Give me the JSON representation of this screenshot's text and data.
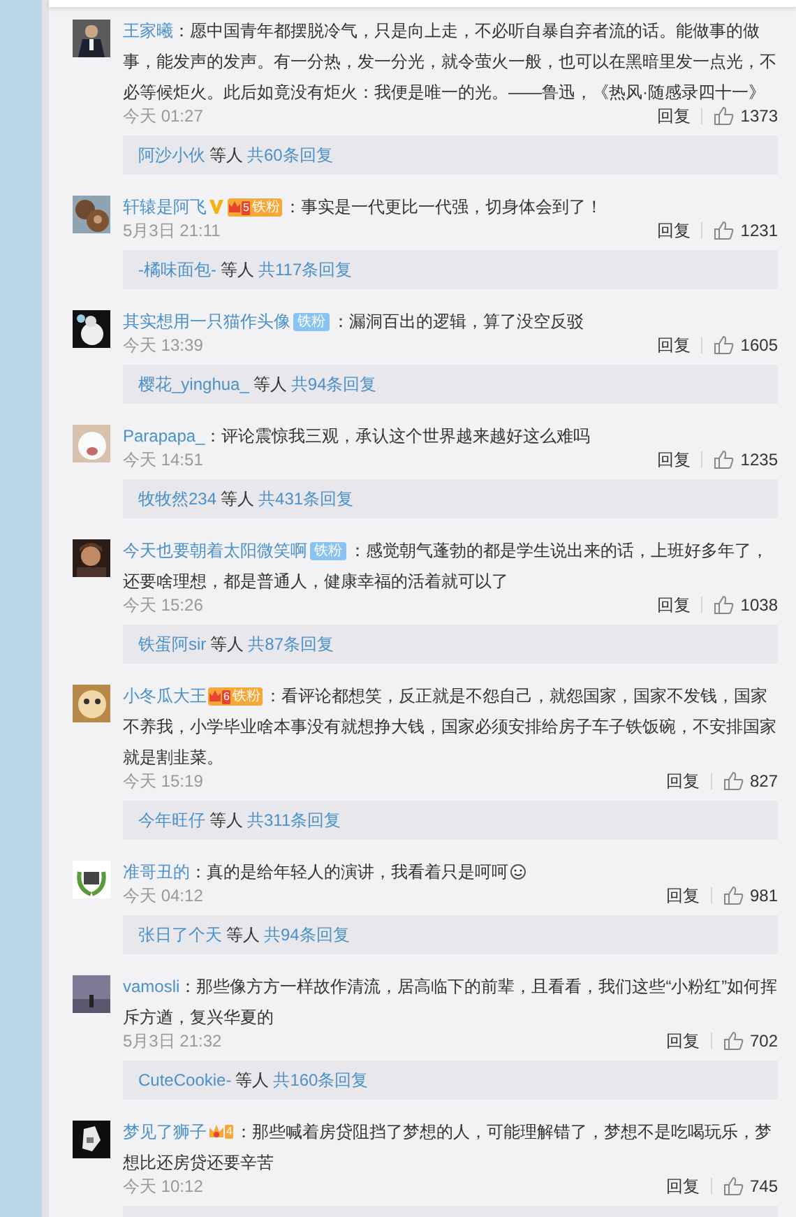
{
  "comments": [
    {
      "name": "王家曦",
      "text": "：愿中国青年都摆脱冷气，只是向上走，不必听自暴自弃者流的话。能做事的做事，能发声的发声。有一分热，发一分光，就令萤火一般，也可以在黑暗里发一点光，不必等候炬火。此后如竟没有炬火：我便是唯一的光。——鲁迅，《热风·随感录四十一》",
      "time": "今天 01:27",
      "reply": "回复",
      "likes": "1373",
      "thread": {
        "user": "阿沙小伙",
        "others": "等人",
        "total": "共60条回复"
      }
    },
    {
      "name": "轩辕是阿飞",
      "badges": [
        {
          "kind": "vip"
        },
        {
          "kind": "fan",
          "level": "5",
          "label": "铁粉"
        }
      ],
      "text": "：事实是一代更比一代强，切身体会到了！",
      "time": "5月3日 21:11",
      "reply": "回复",
      "likes": "1231",
      "thread": {
        "user": "-橘味面包-",
        "others": "等人",
        "total": "共117条回复"
      }
    },
    {
      "name": "其实想用一只猫作头像",
      "badges": [
        {
          "kind": "iron",
          "label": "铁粉"
        }
      ],
      "text": "：漏洞百出的逻辑，算了没空反驳",
      "time": "今天 13:39",
      "reply": "回复",
      "likes": "1605",
      "thread": {
        "user": "樱花_yinghua_",
        "others": "等人",
        "total": "共94条回复"
      }
    },
    {
      "name": "Parapapa_",
      "text": "：评论震惊我三观，承认这个世界越来越好这么难吗",
      "time": "今天 14:51",
      "reply": "回复",
      "likes": "1235",
      "thread": {
        "user": "牧牧然234",
        "others": "等人",
        "total": "共431条回复"
      }
    },
    {
      "name": "今天也要朝着太阳微笑啊",
      "badges": [
        {
          "kind": "iron",
          "label": "铁粉"
        }
      ],
      "text": "：感觉朝气蓬勃的都是学生说出来的话，上班好多年了，还要啥理想，都是普通人，健康幸福的活着就可以了",
      "time": "今天 15:26",
      "reply": "回复",
      "likes": "1038",
      "thread": {
        "user": "铁蛋阿sir",
        "others": "等人",
        "total": "共87条回复"
      }
    },
    {
      "name": "小冬瓜大王",
      "badges": [
        {
          "kind": "fan",
          "level": "6",
          "label": "铁粉"
        }
      ],
      "text": "：看评论都想笑，反正就是不怨自己，就怨国家，国家不发钱，国家不养我，小学毕业啥本事没有就想挣大钱，国家必须安排给房子车子铁饭碗，不安排国家就是割韭菜。",
      "time": "今天 15:19",
      "reply": "回复",
      "likes": "827",
      "thread": {
        "user": "今年旺仔",
        "others": "等人",
        "total": "共311条回复"
      }
    },
    {
      "name": "准哥丑的",
      "text": "：真的是给年轻人的演讲，我看着只是呵呵",
      "emoji": true,
      "time": "今天 04:12",
      "reply": "回复",
      "likes": "981",
      "thread": {
        "user": "张日了个天",
        "others": "等人",
        "total": "共94条回复"
      }
    },
    {
      "name": "vamosli",
      "text": "：那些像方方一样故作清流，居高临下的前辈，且看看，我们这些“小粉红”如何挥斥方遒，复兴华夏的",
      "time": "5月3日 21:32",
      "reply": "回复",
      "likes": "702",
      "thread": {
        "user": "CuteCookie-",
        "others": "等人",
        "total": "共160条回复"
      }
    },
    {
      "name": "梦见了狮子",
      "badges": [
        {
          "kind": "crown",
          "level": "4"
        }
      ],
      "text": "：那些喊着房贷阻挡了梦想的人，可能理解错了，梦想不是吃喝玩乐，梦想比还房贷还要辛苦",
      "time": "今天 10:12",
      "reply": "回复",
      "likes": "745",
      "thread_cut": true
    }
  ]
}
